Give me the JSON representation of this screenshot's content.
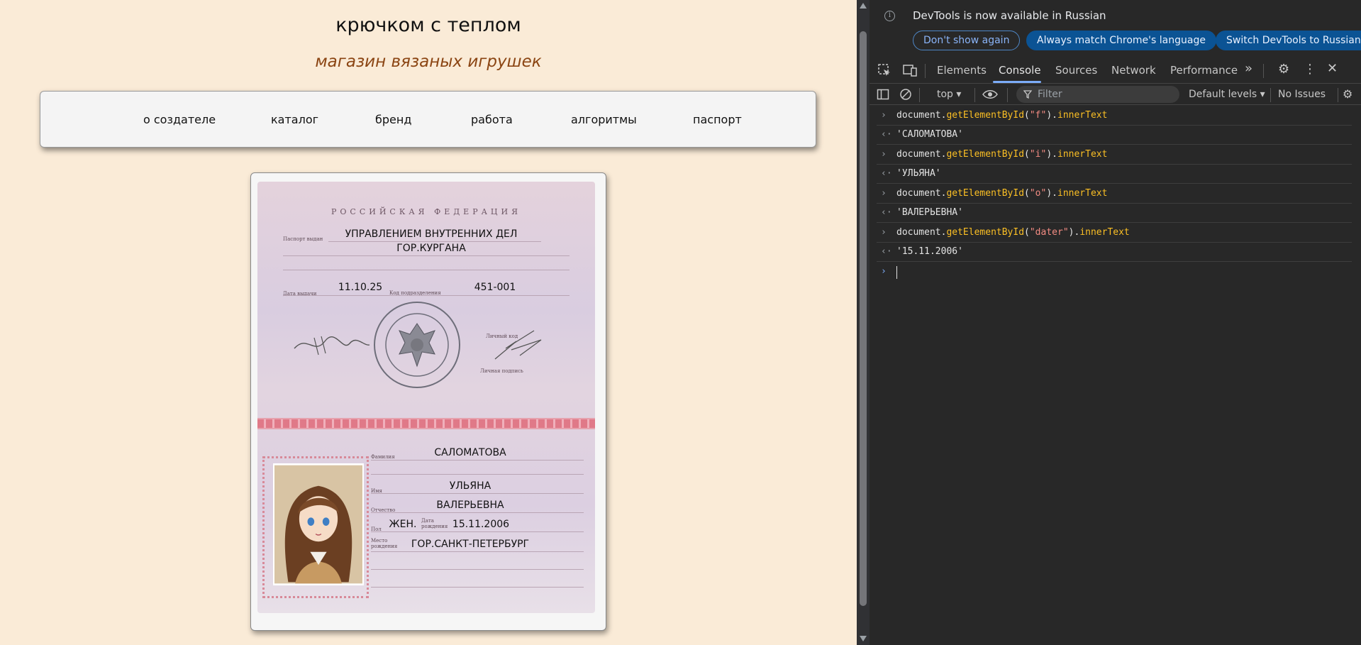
{
  "site": {
    "title": "крючком с теплом",
    "subtitle": "магазин вязаных игрушек",
    "nav": [
      "о создателе",
      "каталог",
      "бренд",
      "работа",
      "алгоритмы",
      "паспорт"
    ]
  },
  "passport": {
    "federation": "РОССИЙСКАЯ ФЕДЕРАЦИЯ",
    "issued_by_label": "Паспорт выдан",
    "issued_by_line1": "УПРАВЛЕНИЕМ ВНУТРЕННИХ ДЕЛ",
    "issued_by_line2": "ГОР.КУРГАНА",
    "issue_date_label": "Дата выдачи",
    "issue_date": "11.10.25",
    "division_code_label": "Код подразделения",
    "division_code": "451-001",
    "personal_code_label": "Личный код",
    "personal_signature_label": "Личная подпись",
    "surname_label": "Фамилия",
    "surname": "САЛОМАТОВА",
    "name_label": "Имя",
    "name": "УЛЬЯНА",
    "patronymic_label": "Отчество",
    "patronymic": "ВАЛЕРЬЕВНА",
    "sex_label": "Пол",
    "sex": "ЖЕН.",
    "birth_date_label": "Дата рождения",
    "birth_date": "15.11.2006",
    "birth_place_label": "Место рождения",
    "birth_place": "ГОР.САНКТ-ПЕТЕРБУРГ"
  },
  "devtools": {
    "notice": {
      "text": "DevTools is now available in Russian",
      "btn_dont_show": "Don't show again",
      "btn_match": "Always match Chrome's language",
      "btn_switch": "Switch DevTools to Russian"
    },
    "tabs": [
      "Elements",
      "Console",
      "Sources",
      "Network",
      "Performance"
    ],
    "active_tab": "Console",
    "more_tabs": "»",
    "toolbar": {
      "context": "top",
      "filter_placeholder": "Filter",
      "levels": "Default levels",
      "issues": "No Issues"
    },
    "console_entries": [
      {
        "type": "input",
        "obj": "document",
        "method": "getElementById",
        "arg": "\"f\"",
        "prop": "innerText"
      },
      {
        "type": "output",
        "value": "'САЛОМАТОВА'"
      },
      {
        "type": "input",
        "obj": "document",
        "method": "getElementById",
        "arg": "\"i\"",
        "prop": "innerText"
      },
      {
        "type": "output",
        "value": "'УЛЬЯНА'"
      },
      {
        "type": "input",
        "obj": "document",
        "method": "getElementById",
        "arg": "\"o\"",
        "prop": "innerText"
      },
      {
        "type": "output",
        "value": "'ВАЛЕРЬЕВНА'"
      },
      {
        "type": "input",
        "obj": "document",
        "method": "getElementById",
        "arg": "\"dater\"",
        "prop": "innerText"
      },
      {
        "type": "output",
        "value": "'15.11.2006'"
      }
    ]
  },
  "colors": {
    "page_bg": "#faebd7",
    "subtitle": "#8b4513",
    "devtools_bg": "#282828",
    "accent": "#7cacf8"
  }
}
